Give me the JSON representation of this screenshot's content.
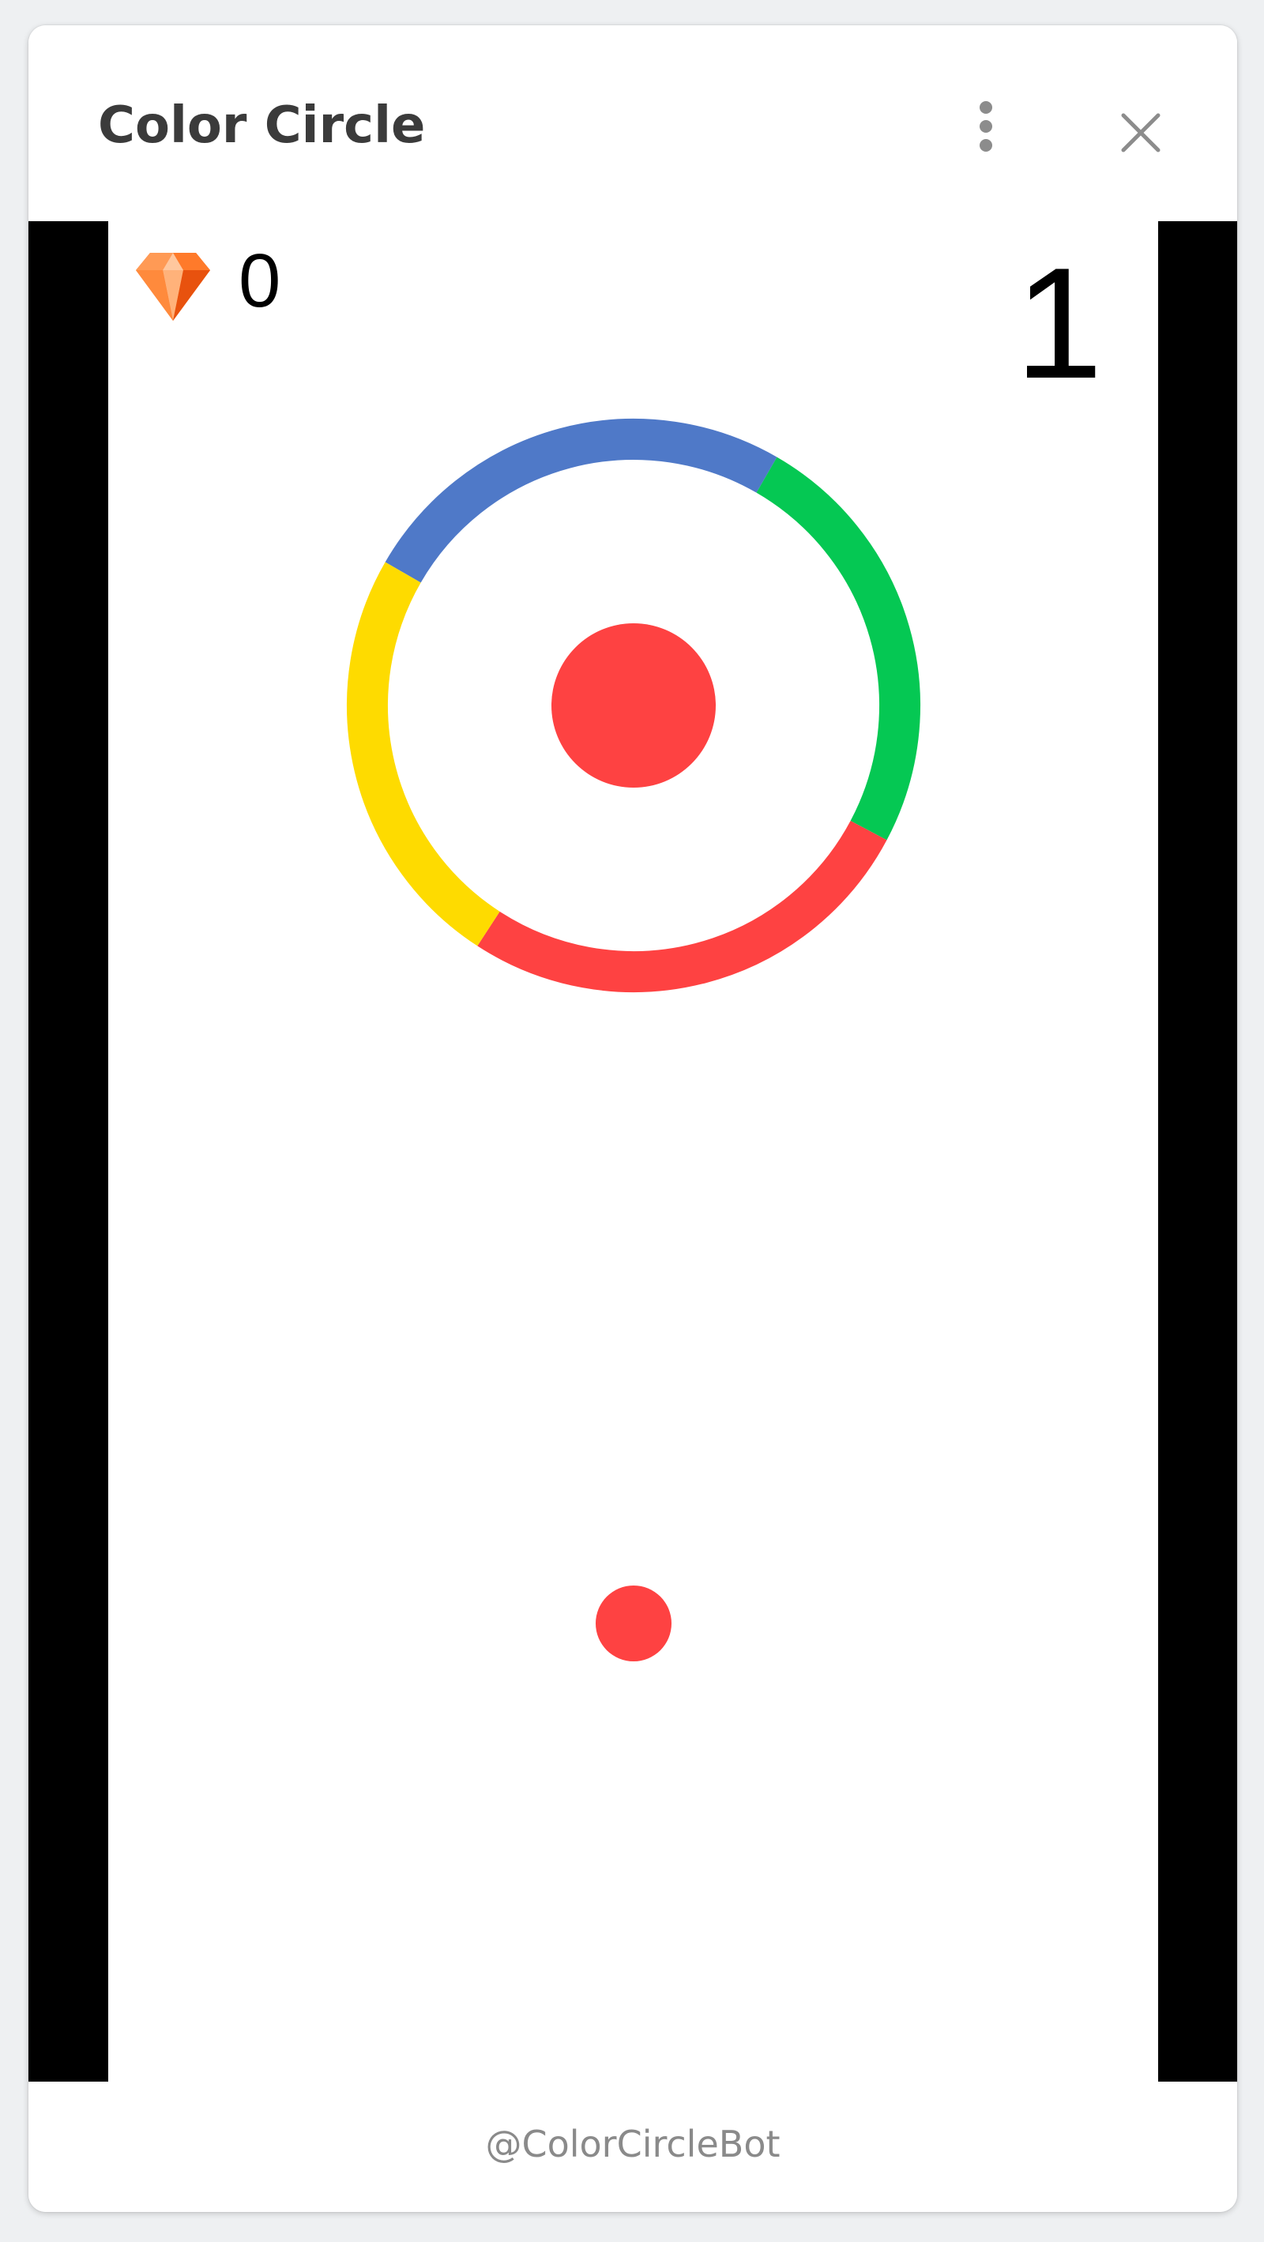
{
  "window": {
    "title": "Color Circle",
    "menu_icon": "more-vertical-icon",
    "close_icon": "close-icon"
  },
  "hud": {
    "gem_icon": "gem-icon",
    "gem_count": "0",
    "score": "1"
  },
  "game": {
    "ring_segments": [
      {
        "color": "#4f79c8",
        "name": "blue"
      },
      {
        "color": "#05c853",
        "name": "green"
      },
      {
        "color": "#fe4242",
        "name": "red"
      },
      {
        "color": "#fedb00",
        "name": "yellow"
      }
    ],
    "center_dot_color": "#fe4242",
    "player_ball_color": "#fe4242",
    "wall_color": "#000000"
  },
  "footer": {
    "handle": "@ColorCircleBot"
  }
}
